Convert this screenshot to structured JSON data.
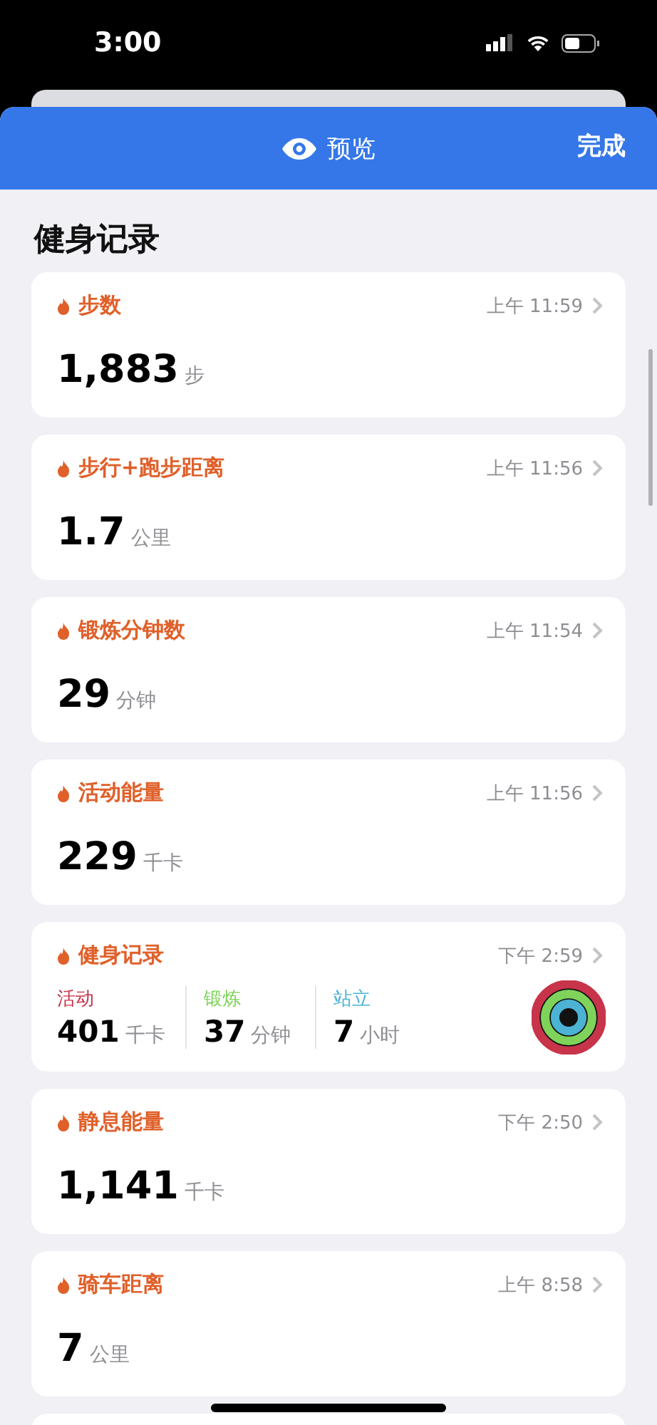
{
  "status_bar": {
    "time": "3:00"
  },
  "header": {
    "title": "预览",
    "done": "完成"
  },
  "section_title": "健身记录",
  "cards": [
    {
      "kind": "metric",
      "title": "步数",
      "time": "上午 11:59",
      "value": "1,883",
      "unit": "步"
    },
    {
      "kind": "metric",
      "title": "步行+跑步距离",
      "time": "上午 11:56",
      "value": "1.7",
      "unit": "公里"
    },
    {
      "kind": "metric",
      "title": "锻炼分钟数",
      "time": "上午 11:54",
      "value": "29",
      "unit": "分钟"
    },
    {
      "kind": "metric",
      "title": "活动能量",
      "time": "上午 11:56",
      "value": "229",
      "unit": "千卡"
    },
    {
      "kind": "activity",
      "title": "健身记录",
      "time": "下午 2:59",
      "rings": [
        {
          "label": "活动",
          "color": "#c8344a",
          "value": "401",
          "unit": "千卡"
        },
        {
          "label": "锻炼",
          "color": "#7fd35a",
          "value": "37",
          "unit": "分钟"
        },
        {
          "label": "站立",
          "color": "#4cb3d4",
          "value": "7",
          "unit": "小时"
        }
      ]
    },
    {
      "kind": "metric",
      "title": "静息能量",
      "time": "下午 2:50",
      "value": "1,141",
      "unit": "千卡"
    },
    {
      "kind": "metric",
      "title": "骑车距离",
      "time": "上午 8:58",
      "value": "7",
      "unit": "公里"
    }
  ]
}
